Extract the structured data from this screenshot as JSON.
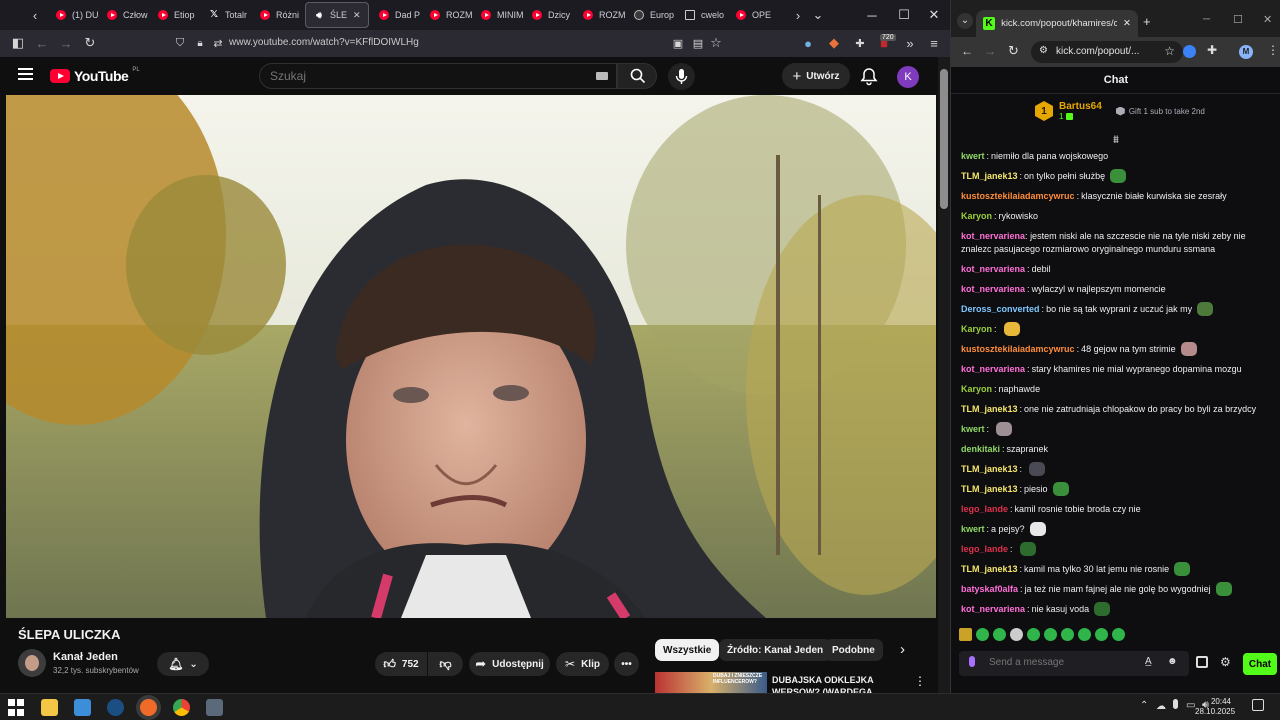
{
  "firefox": {
    "tabs": [
      {
        "label": "(1) DU",
        "icon": "youtube-icon"
      },
      {
        "label": "Człow",
        "icon": "youtube-icon"
      },
      {
        "label": "Etiop",
        "icon": "youtube-icon"
      },
      {
        "label": "Totalr",
        "icon": "x-icon"
      },
      {
        "label": "Różni",
        "icon": "youtube-icon"
      },
      {
        "label": "ŚLE",
        "icon": "speaker-icon",
        "active": true
      },
      {
        "label": "Dad P",
        "icon": "youtube-icon"
      },
      {
        "label": "ROZM",
        "icon": "youtube-icon"
      },
      {
        "label": "MINIM",
        "icon": "youtube-icon"
      },
      {
        "label": "Dzicy",
        "icon": "youtube-icon"
      },
      {
        "label": "ROZM",
        "icon": "youtube-icon"
      },
      {
        "label": "Europ",
        "icon": "globe-icon"
      },
      {
        "label": "cwelo",
        "icon": "spreadsheet-icon"
      },
      {
        "label": "OPE",
        "icon": "youtube-icon"
      }
    ],
    "url": "www.youtube.com/watch?v=KFflDOIWLHg",
    "badge_count": "720"
  },
  "youtube": {
    "logo_text": "YouTube",
    "region": "PL",
    "search_placeholder": "Szukaj",
    "create_label": "Utwórz",
    "avatar_letter": "K",
    "video_title": "ŚLEPA ULICZKA",
    "channel_name": "Kanał Jeden",
    "subscribers": "32,2 tys. subskrybentów",
    "likes": "752",
    "share_label": "Udostępnij",
    "clip_label": "Klip",
    "chips": [
      "Wszystkie",
      "Źródło: Kanał Jeden",
      "Podobne"
    ],
    "rec_title": "DUBAJSKA ODKLEJKA WERSOW? (WARDEGA, NITRO",
    "rec_thumb_text": "DUBAJ I ZNIESZCZE INFLUENCEROW?"
  },
  "kick": {
    "tab_title": "kick.com/popout/khamires/cha",
    "url": "kick.com/popout/...",
    "avatar_letter": "M",
    "header": "Chat",
    "pinned_user": "Bartus64",
    "pinned_level": "1",
    "gift_text": "Gift 1 sub to take 2nd",
    "send_placeholder": "Send a message",
    "chat_button": "Chat",
    "messages": [
      {
        "user": "kwert",
        "color": "#8fd866",
        "text": "niemiło dla pana wojskowego"
      },
      {
        "user": "TLM_janek13",
        "color": "#f5e66e",
        "text": "on tylko pełni służbę",
        "emote": "#3a8f3a"
      },
      {
        "user": "kustosztekilaiadamcywruc",
        "color": "#ff8d3b",
        "text": "klasycznie białe kurwiska sie zesrały"
      },
      {
        "user": "Karyon",
        "color": "#9bd03b",
        "text": "rykowisko"
      },
      {
        "user": "kot_nervariena",
        "color": "#ff6fd6",
        "text": "jestem niski ale na szczescie nie na tyle niski zeby nie znalezc pasujacego rozmiarowo oryginalnego munduru ssmana",
        "wrap": true
      },
      {
        "user": "kot_nervariena",
        "color": "#ff6fd6",
        "text": "debil"
      },
      {
        "user": "kot_nervariena",
        "color": "#ff6fd6",
        "text": "wylaczyl w najlepszym momencie"
      },
      {
        "user": "Deross_converted",
        "color": "#7ec8ff",
        "text": "bo nie są tak wyprani z uczuć jak my",
        "emote": "#4d7a3a"
      },
      {
        "user": "Karyon",
        "color": "#9bd03b",
        "text": "",
        "emote": "#e8b83a"
      },
      {
        "user": "kustosztekilaiadamcywruc",
        "color": "#ff8d3b",
        "text": "48 gejow na tym strimie",
        "emote": "#b58a8a"
      },
      {
        "user": "kot_nervariena",
        "color": "#ff6fd6",
        "text": "stary khamires nie mial wypranego dopamina mozgu"
      },
      {
        "user": "Karyon",
        "color": "#9bd03b",
        "text": "naphawde"
      },
      {
        "user": "TLM_janek13",
        "color": "#f5e66e",
        "text": "one nie zatrudniaja chlopakow do pracy bo byli za brzydcy"
      },
      {
        "user": "kwert",
        "color": "#8fd866",
        "text": "",
        "emote": "#9e8f95"
      },
      {
        "user": "denkitaki",
        "color": "#8fd866",
        "text": "szapranek"
      },
      {
        "user": "TLM_janek13",
        "color": "#f5e66e",
        "text": "",
        "emote": "#4a4a55"
      },
      {
        "user": "TLM_janek13",
        "color": "#f5e66e",
        "text": "piesio",
        "emote": "#3a8f3a"
      },
      {
        "user": "lego_lande",
        "color": "#e0324d",
        "text": "kamil rosnie tobie broda czy nie"
      },
      {
        "user": "kwert",
        "color": "#8fd866",
        "text": "a pejsy?",
        "emote": "#e8e8e8"
      },
      {
        "user": "lego_lande",
        "color": "#e0324d",
        "text": "",
        "emote": "#2e6b2e"
      },
      {
        "user": "TLM_janek13",
        "color": "#f5e66e",
        "text": "kamil ma tylko 30 lat jemu nie rosnie",
        "emote": "#3a8f3a"
      },
      {
        "user": "batyskaf0alfa",
        "color": "#ff6fd6",
        "text": "ja też nie mam fajnej ale nie golę bo wygodniej",
        "emote": "#3a8f3a"
      },
      {
        "user": "kot_nervariena",
        "color": "#ff6fd6",
        "text": "nie kasuj voda",
        "emote": "#2e6b2e"
      }
    ]
  },
  "taskbar": {
    "time": "20:44",
    "date": "28.10.2025"
  }
}
